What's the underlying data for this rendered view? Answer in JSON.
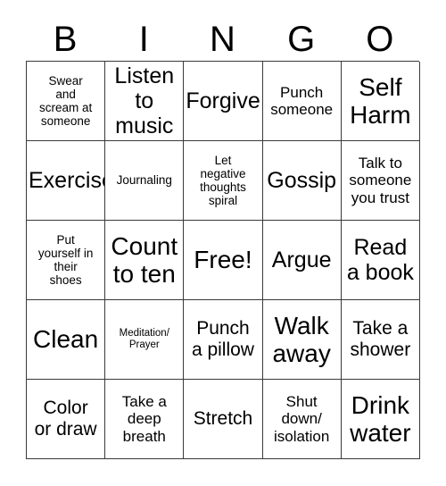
{
  "card": {
    "header": {
      "letters": [
        "B",
        "I",
        "N",
        "G",
        "O"
      ]
    },
    "rows": [
      [
        {
          "text": "Swear\nand\nscream at\nsomeone",
          "size": "sz-sm"
        },
        {
          "text": "Listen\nto\nmusic",
          "size": "sz-xl"
        },
        {
          "text": "Forgive",
          "size": "sz-xl"
        },
        {
          "text": "Punch\nsomeone",
          "size": "sz-md"
        },
        {
          "text": "Self\nHarm",
          "size": "sz-xxl"
        }
      ],
      [
        {
          "text": "Exercise",
          "size": "sz-xl"
        },
        {
          "text": "Journaling",
          "size": "sz-sm"
        },
        {
          "text": "Let\nnegative\nthoughts\nspiral",
          "size": "sz-sm"
        },
        {
          "text": "Gossip",
          "size": "sz-xl"
        },
        {
          "text": "Talk to\nsomeone\nyou trust",
          "size": "sz-md"
        }
      ],
      [
        {
          "text": "Put\nyourself in\ntheir\nshoes",
          "size": "sz-sm"
        },
        {
          "text": "Count\nto ten",
          "size": "sz-xxl"
        },
        {
          "text": "Free!",
          "size": "sz-xxl"
        },
        {
          "text": "Argue",
          "size": "sz-xl"
        },
        {
          "text": "Read\na book",
          "size": "sz-xl"
        }
      ],
      [
        {
          "text": "Clean",
          "size": "sz-xxl"
        },
        {
          "text": "Meditation/\nPrayer",
          "size": "sz-xs"
        },
        {
          "text": "Punch\na pillow",
          "size": "sz-lg"
        },
        {
          "text": "Walk\naway",
          "size": "sz-xxl"
        },
        {
          "text": "Take a\nshower",
          "size": "sz-lg"
        }
      ],
      [
        {
          "text": "Color\nor draw",
          "size": "sz-lg"
        },
        {
          "text": "Take a\ndeep\nbreath",
          "size": "sz-md"
        },
        {
          "text": "Stretch",
          "size": "sz-lg"
        },
        {
          "text": "Shut\ndown/\nisolation",
          "size": "sz-md"
        },
        {
          "text": "Drink\nwater",
          "size": "sz-xxl"
        }
      ]
    ]
  }
}
